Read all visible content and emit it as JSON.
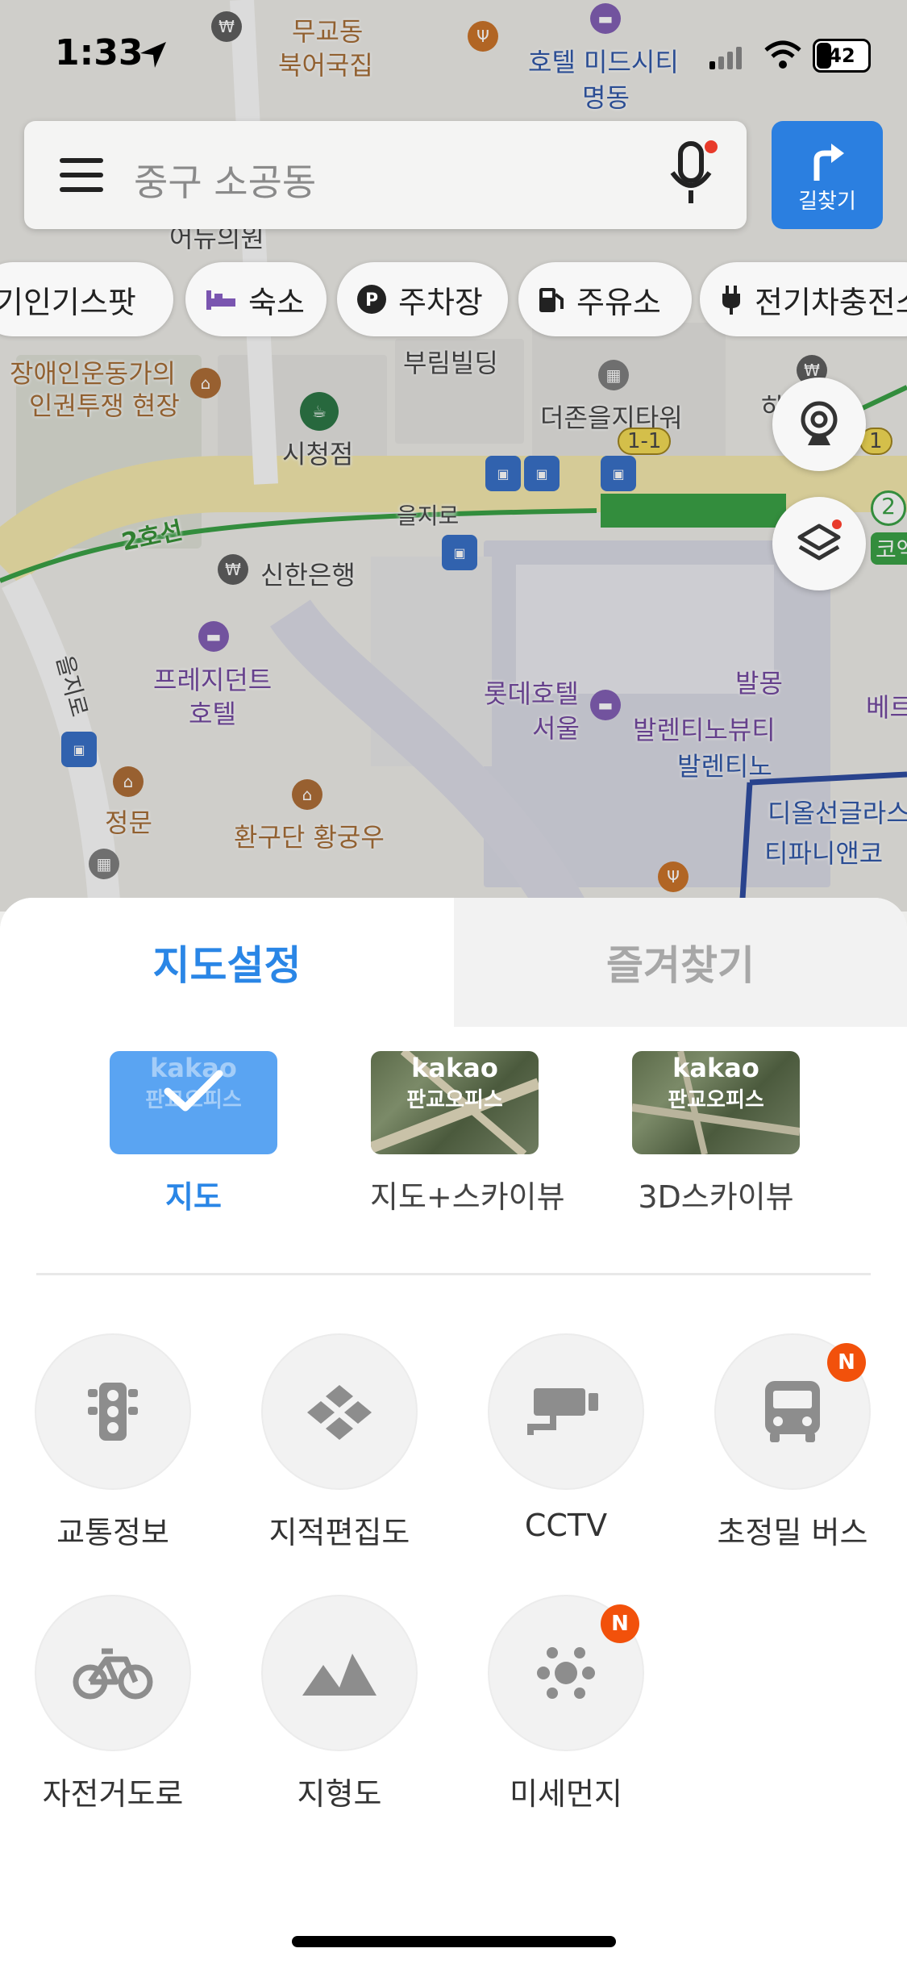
{
  "status_bar": {
    "time": "1:33",
    "battery": "42"
  },
  "search": {
    "placeholder": "중구 소공동",
    "directions_label": "길찾기"
  },
  "chips": [
    "인기스팟",
    "숙소",
    "주차장",
    "주유소",
    "전기차충전소"
  ],
  "chips_partial_prefix": "기 ",
  "map_labels": {
    "l1": "무교동",
    "l2": "북어국집",
    "l3": "호텔 미드시티",
    "l4": "명동",
    "l5": "어뉴의원",
    "l6": "장애인운동가의",
    "l7": "인권투쟁 현장",
    "l8": "부림빌딩",
    "l9": "더존을지타워",
    "l10": "시청점",
    "l11": "을지로",
    "l12": "2호선",
    "l13": "신한은행",
    "l14": "프레지던트",
    "l15": "호텔",
    "l16": "롯데호텔",
    "l17": "서울",
    "l18": "발렌티노뷰티",
    "l19": "발렌티노",
    "l20": "디올선글라스",
    "l21": "티파니앤코",
    "l22": "발몽",
    "l23": "정문",
    "l24": "환구단 황궁우",
    "l25": "을지로",
    "l26": "1-1",
    "l27": "1",
    "l28": "2",
    "l29": "코엑",
    "l30": "베르",
    "l31": "하"
  },
  "sheet": {
    "tab_active": "지도설정",
    "tab_inactive": "즐겨찾기",
    "map_types": [
      {
        "label": "지도",
        "selected": true
      },
      {
        "label": "지도+스카이뷰",
        "selected": false
      },
      {
        "label": "3D스카이뷰",
        "selected": false
      }
    ],
    "thumb_brand": "kakao",
    "thumb_sub": "판교오피스",
    "layers": [
      {
        "label": "교통정보",
        "icon": "traffic-light-icon",
        "new": false
      },
      {
        "label": "지적편집도",
        "icon": "cadastral-map-icon",
        "new": false
      },
      {
        "label": "CCTV",
        "icon": "cctv-icon",
        "new": false
      },
      {
        "label": "초정밀 버스",
        "icon": "bus-icon",
        "new": true
      },
      {
        "label": "자전거도로",
        "icon": "bicycle-icon",
        "new": false
      },
      {
        "label": "지형도",
        "icon": "mountain-icon",
        "new": false
      },
      {
        "label": "미세먼지",
        "icon": "fine-dust-icon",
        "new": true
      }
    ],
    "new_badge": "N"
  },
  "colors": {
    "accent": "#2a86e6",
    "badge": "#f2510b",
    "subway_line2": "#2e9b3a",
    "bus_stop": "#2b67c4"
  }
}
